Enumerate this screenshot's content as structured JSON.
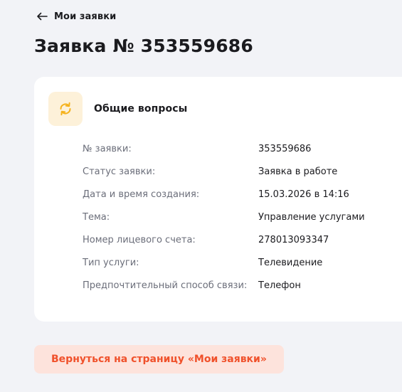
{
  "header": {
    "back_label": "Мои заявки",
    "title": "Заявка № 353559686"
  },
  "card": {
    "category_icon": "refresh-icon",
    "category_title": "Общие вопросы",
    "details": [
      {
        "label": "№ заявки:",
        "value": "353559686"
      },
      {
        "label": "Статус заявки:",
        "value": "Заявка в работе"
      },
      {
        "label": "Дата и время создания:",
        "value": "15.03.2026 в 14:16"
      },
      {
        "label": "Тема:",
        "value": "Управление услугами"
      },
      {
        "label": "Номер лицевого счета:",
        "value": "278013093347"
      },
      {
        "label": "Тип услуги:",
        "value": "Телевидение"
      },
      {
        "label": "Предпочтительный способ связи:",
        "value": "Телефон"
      }
    ]
  },
  "footer": {
    "return_label": "Вернуться на страницу «Мои заявки»"
  },
  "colors": {
    "background": "#f2f3f7",
    "card": "#ffffff",
    "accent": "#f0512b",
    "accent_bg": "#fde3dc",
    "icon_color": "#f5b21c",
    "icon_bg": "#fdf1d9"
  }
}
